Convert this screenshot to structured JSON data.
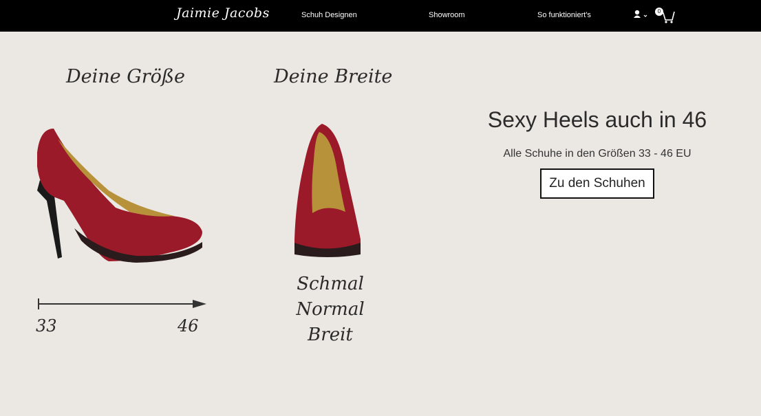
{
  "header": {
    "logo": "Jaimie Jacobs",
    "nav": [
      "Schuh Designen",
      "Showroom",
      "So funktioniert's"
    ],
    "cart_count": "0"
  },
  "size_section": {
    "heading": "Deine Größe",
    "min": "33",
    "max": "46"
  },
  "width_section": {
    "heading": "Deine Breite",
    "options": [
      "Schmal",
      "Normal",
      "Breit"
    ]
  },
  "promo": {
    "title": "Sexy Heels auch in 46",
    "subtitle": "Alle Schuhe in den Größen 33 - 46 EU",
    "cta": "Zu den Schuhen"
  },
  "colors": {
    "background": "#ebe8e3",
    "header": "#000000",
    "shoe": "#9a1a2a"
  }
}
